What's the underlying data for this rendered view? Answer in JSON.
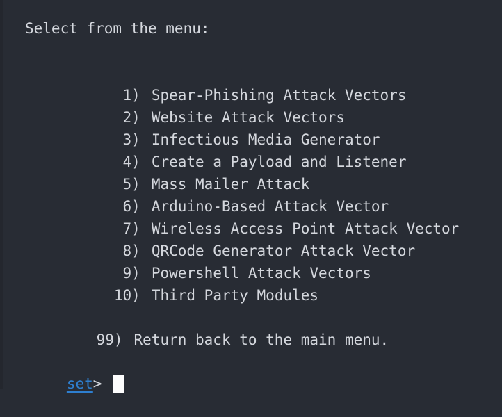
{
  "terminal": {
    "background_color": "#282c34",
    "text_color": "#d4d7dd",
    "prompt_color": "#2e7fd0",
    "cursor_color": "#fdfdfd",
    "heading": "Select from the menu:",
    "menu_items": [
      {
        "key": "1",
        "paren": ")",
        "label": "Spear-Phishing Attack Vectors"
      },
      {
        "key": "2",
        "paren": ")",
        "label": "Website Attack Vectors"
      },
      {
        "key": "3",
        "paren": ")",
        "label": "Infectious Media Generator"
      },
      {
        "key": "4",
        "paren": ")",
        "label": "Create a Payload and Listener"
      },
      {
        "key": "5",
        "paren": ")",
        "label": "Mass Mailer Attack"
      },
      {
        "key": "6",
        "paren": ")",
        "label": "Arduino-Based Attack Vector"
      },
      {
        "key": "7",
        "paren": ")",
        "label": "Wireless Access Point Attack Vector"
      },
      {
        "key": "8",
        "paren": ")",
        "label": "QRCode Generator Attack Vector"
      },
      {
        "key": "9",
        "paren": ")",
        "label": "Powershell Attack Vectors"
      },
      {
        "key": "10",
        "paren": ")",
        "label": "Third Party Modules"
      }
    ],
    "return_item": {
      "key": "99",
      "paren": ")",
      "label": "Return back to the main menu."
    },
    "prompt": {
      "name": "set",
      "arrow": ">",
      "input_value": ""
    }
  }
}
